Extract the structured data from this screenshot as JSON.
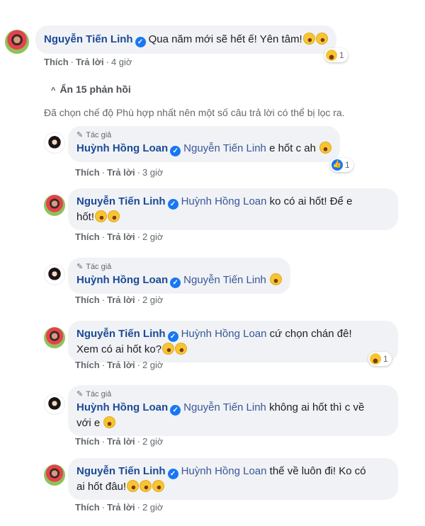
{
  "labels": {
    "like": "Thích",
    "reply": "Trả lời",
    "sep": "·",
    "author_tag": "Tác giả"
  },
  "top_comment": {
    "name": "Nguyễn Tiến Linh",
    "text": "Qua năm mới sẽ hết ế! Yên tâm!",
    "time": "4 giờ",
    "reaction": "haha-icon",
    "reaction_count": "1"
  },
  "hide_replies": "Ẩn 15 phản hồi",
  "filter_note": "Đã chọn chế độ Phù hợp nhất nên một số câu trả lời có thể bị lọc ra.",
  "replies": [
    {
      "name": "Huỳnh Hồng Loan",
      "mention": "Nguyễn Tiến Linh",
      "text": "e hốt c ah",
      "time": "3 giờ",
      "reaction": "like-icon",
      "reaction_count": "1"
    },
    {
      "name": "Nguyễn Tiến Linh",
      "mention": "Huỳnh Hồng Loan",
      "text_line1": "ko có ai hốt! Để e",
      "text_line2": "hốt!",
      "time": "2 giờ"
    },
    {
      "name": "Huỳnh Hồng Loan",
      "mention": "Nguyễn Tiến Linh",
      "text": "",
      "time": "2 giờ"
    },
    {
      "name": "Nguyễn Tiến Linh",
      "mention": "Huỳnh Hồng Loan",
      "text_line1": "cứ chọn chán đê!",
      "text_line2": "Xem có ai hốt ko?",
      "time": "2 giờ",
      "reaction": "haha-icon",
      "reaction_count": "1"
    },
    {
      "name": "Huỳnh Hồng Loan",
      "mention": "Nguyễn Tiến Linh",
      "text_line1": "không ai hốt thì c về",
      "text_line2": "với e",
      "time": "2 giờ"
    },
    {
      "name": "Nguyễn Tiến Linh",
      "mention": "Huỳnh Hồng Loan",
      "text_line1": "thế về luôn đi! Ko có",
      "text_line2": "ai hốt đâu!",
      "time": "2 giờ"
    }
  ],
  "colors": {
    "name": "#1c4a96",
    "mention": "#385898",
    "bubble": "#f0f2f5",
    "meta": "#65676b",
    "verified": "#1877f2"
  }
}
